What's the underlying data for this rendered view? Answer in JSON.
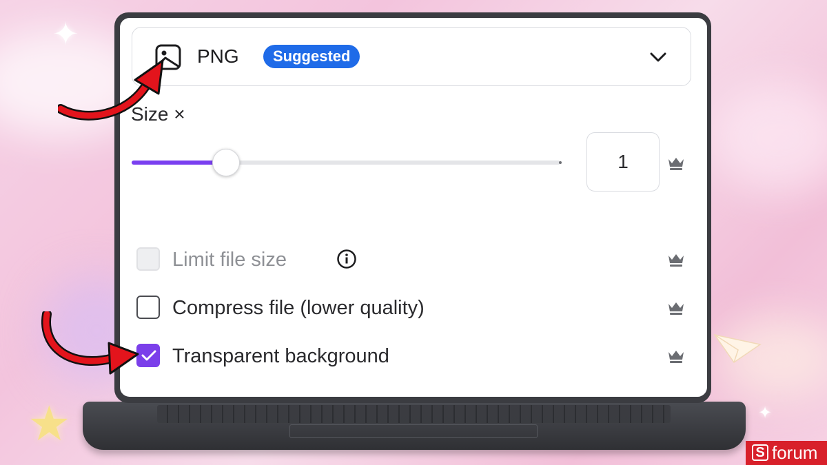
{
  "format": {
    "name": "PNG",
    "badge": "Suggested",
    "icon": "image-icon",
    "dropdown_icon": "chevron-down-icon"
  },
  "size": {
    "label": "Size ×",
    "value": "1",
    "slider_fraction": 0.22
  },
  "options": [
    {
      "label": "Limit file size",
      "state": "disabled",
      "has_info": true
    },
    {
      "label": "Compress file (lower quality)",
      "state": "unchecked"
    },
    {
      "label": "Transparent background",
      "state": "checked"
    }
  ],
  "premium_icon": "crown-icon",
  "colors": {
    "accent": "#7b3fea",
    "badge": "#1f6be8",
    "arrow": "#e3141c",
    "logo": "#d8202a"
  },
  "watermark": {
    "mark": "S",
    "text": "forum"
  }
}
